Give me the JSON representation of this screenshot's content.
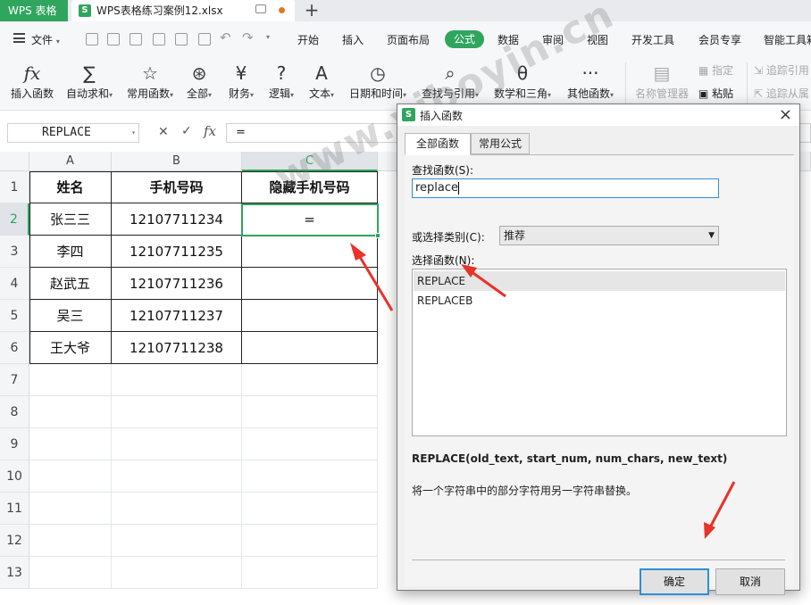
{
  "titlebar": {
    "app_label": "WPS 表格",
    "doc_tab": "WPS表格练习案例12.xlsx",
    "doc_icon": "S"
  },
  "menu": {
    "file": "文件",
    "items": [
      "开始",
      "插入",
      "页面布局",
      "公式",
      "数据",
      "审阅",
      "视图",
      "开发工具",
      "会员专享",
      "智能工具箱"
    ],
    "active": "公式"
  },
  "ribbon": {
    "items": [
      {
        "label": "插入函数",
        "icon": "fx-icon",
        "glyph": "fx"
      },
      {
        "label": "自动求和",
        "icon": "sigma-icon",
        "glyph": "∑"
      },
      {
        "label": "常用函数",
        "icon": "star-icon",
        "glyph": "☆"
      },
      {
        "label": "全部",
        "icon": "asterisk-icon",
        "glyph": "⊛"
      },
      {
        "label": "财务",
        "icon": "yen-icon",
        "glyph": "¥"
      },
      {
        "label": "逻辑",
        "icon": "question-icon",
        "glyph": "?"
      },
      {
        "label": "文本",
        "icon": "text-a-icon",
        "glyph": "A"
      },
      {
        "label": "日期和时间",
        "icon": "clock-icon",
        "glyph": "◷"
      },
      {
        "label": "查找与引用",
        "icon": "magnifier-icon",
        "glyph": "⌕"
      },
      {
        "label": "数学和三角",
        "icon": "theta-icon",
        "glyph": "θ"
      },
      {
        "label": "其他函数",
        "icon": "more-icon",
        "glyph": "···"
      },
      {
        "label": "名称管理器",
        "icon": "name-manager-icon",
        "glyph": "▤"
      },
      {
        "label": "指定",
        "icon": "specify-icon",
        "glyph": "▦"
      },
      {
        "label": "粘贴",
        "icon": "paste-icon",
        "glyph": "▣"
      },
      {
        "label": "追踪引用",
        "icon": "trace-precedents-icon",
        "glyph": "⇲"
      },
      {
        "label": "追踪从属",
        "icon": "trace-dependents-icon",
        "glyph": "⇱"
      }
    ]
  },
  "formula_bar": {
    "name_box": "REPLACE",
    "cancel": "✕",
    "confirm": "✓",
    "fx": "fx",
    "content": "="
  },
  "sheet": {
    "columns": [
      "A",
      "B",
      "C"
    ],
    "rows": [
      "1",
      "2",
      "3",
      "4",
      "5",
      "6",
      "7",
      "8",
      "9",
      "10",
      "11",
      "12",
      "13"
    ],
    "header": [
      "姓名",
      "手机号码",
      "隐藏手机号码"
    ],
    "data": [
      [
        "张三三",
        "12107711234",
        "="
      ],
      [
        "李四",
        "12107711235",
        ""
      ],
      [
        "赵武五",
        "12107711236",
        ""
      ],
      [
        "吴三",
        "12107711237",
        ""
      ],
      [
        "王大爷",
        "12107711238",
        ""
      ]
    ],
    "active_cell": "C2"
  },
  "dialog": {
    "title": "插入函数",
    "close": "×",
    "tabs": [
      "全部函数",
      "常用公式"
    ],
    "search_label": "查找函数(S):",
    "search_value": "replace",
    "category_label": "或选择类别(C):",
    "category_value": "推荐",
    "select_label": "选择函数(N):",
    "functions": [
      "REPLACE",
      "REPLACEB"
    ],
    "signature": "REPLACE(old_text, start_num, num_chars, new_text)",
    "description": "将一个字符串中的部分字符用另一字符串替换。",
    "ok": "确定",
    "cancel": "取消"
  },
  "watermark": "www.yiboyin.cn",
  "colors": {
    "brand_green": "#2fa55e",
    "focus_blue": "#2d8fd7",
    "annotation_red": "#e8322a"
  }
}
